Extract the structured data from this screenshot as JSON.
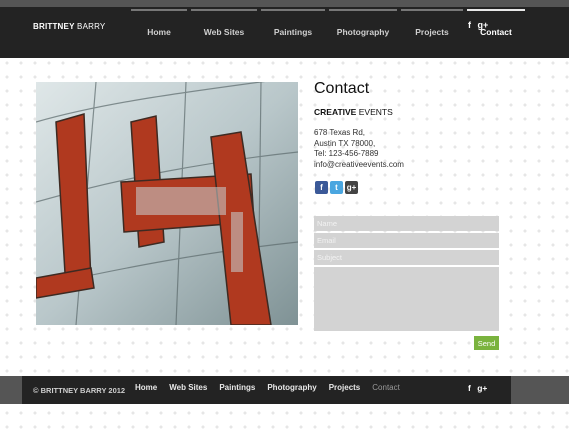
{
  "header": {
    "brand_first": "BRITTNEY",
    "brand_last": "BARRY",
    "nav": [
      "Home",
      "Web Sites",
      "Paintings",
      "Photography",
      "Projects",
      "Contact"
    ],
    "social": {
      "facebook": "f",
      "googleplus": "g+"
    }
  },
  "contact": {
    "title": "Contact",
    "company_bold": "CREATIVE",
    "company_rest": "EVENTS",
    "address_line1": "678 Texas Rd,",
    "address_line2": "Austin TX 78000,",
    "phone": "Tel: 123-456-7889",
    "email": "info@creativeevents.com",
    "social_icons": {
      "facebook": "f",
      "twitter": "t",
      "googleplus": "g+"
    }
  },
  "form": {
    "name_placeholder": "Name",
    "email_placeholder": "Email",
    "subject_placeholder": "Subject",
    "send_label": "Send"
  },
  "footer": {
    "copyright": "© BRITTNEY BARRY 2012",
    "nav": [
      "Home",
      "Web Sites",
      "Paintings",
      "Photography",
      "Projects",
      "Contact"
    ],
    "social": {
      "facebook": "f",
      "googleplus": "g+"
    }
  },
  "colors": {
    "bar": "#232323",
    "send_button": "#7ab33e",
    "field": "#d3d3d3"
  }
}
